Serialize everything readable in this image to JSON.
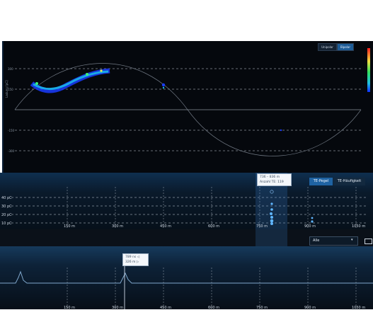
{
  "prpd": {
    "toggle_unipolar": "Unipolar",
    "toggle_bipolar": "Bipolar",
    "y_axis_label": "Ladung [pC]",
    "y_ticks": [
      "300",
      "150",
      "-150",
      "-300"
    ]
  },
  "map": {
    "tab_te_pegel": "TE-Pegel",
    "tab_te_haeufigkeit": "TE-Häufigkeit",
    "tooltip_range": "736 – 836 m",
    "tooltip_count": "Anzahl TE: 119",
    "pc_labels": [
      "40 pC",
      "30 pC",
      "20 pC",
      "10 pC"
    ],
    "x_ticks": [
      "150 m",
      "300 m",
      "450 m",
      "600 m",
      "750 m",
      "900 m",
      "1050 m"
    ],
    "filter_value": "Alle",
    "colors": {
      "accent": "#1f63a3",
      "background": "#0a1a2b"
    }
  },
  "trace": {
    "tooltip_line1": "789 ns ◁",
    "tooltip_line2": "326 m ▷",
    "x_ticks": [
      "150 m",
      "300 m",
      "450 m",
      "600 m",
      "750 m",
      "900 m",
      "1050 m"
    ],
    "colors": {
      "trace": "#7fa7cc"
    }
  }
}
